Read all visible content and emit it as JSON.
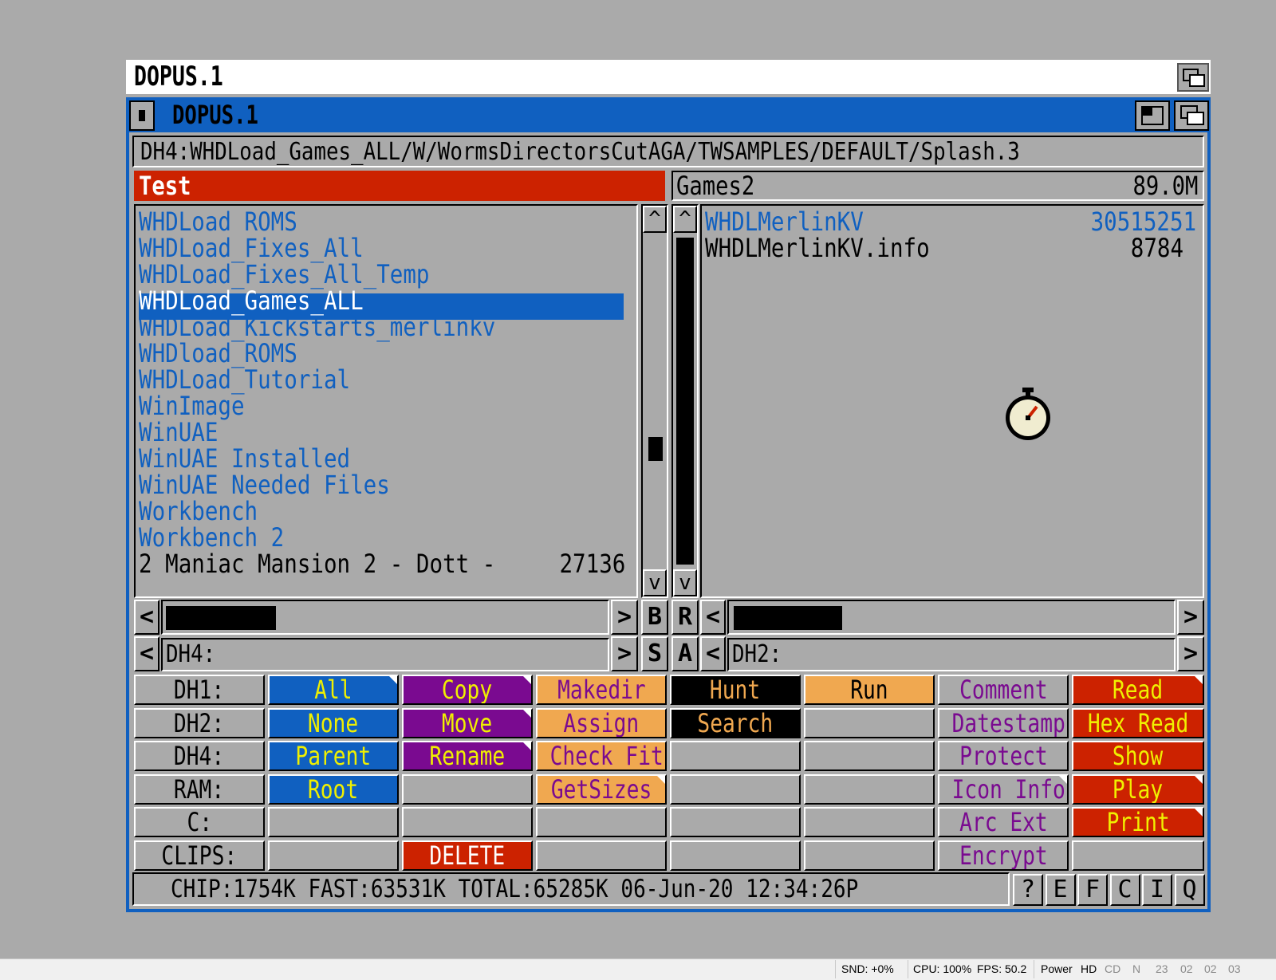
{
  "screen": {
    "title": "DOPUS.1"
  },
  "window": {
    "title": "DOPUS.1"
  },
  "path": "DH4:WHDLoad_Games_ALL/W/WormsDirectorsCutAGA/TWSAMPLES/DEFAULT/Splash.3",
  "left_lister": {
    "header": "Test",
    "entries": [
      {
        "name": "WHDLoad ROMS",
        "type": "dir"
      },
      {
        "name": "WHDLoad_Fixes_All",
        "type": "dir"
      },
      {
        "name": "WHDLoad_Fixes_All_Temp",
        "type": "dir"
      },
      {
        "name": "WHDLoad_Games_ALL",
        "type": "dir",
        "selected": true
      },
      {
        "name": "WHDLoad_Kickstarts_merlinkv",
        "type": "dir"
      },
      {
        "name": "WHDload_ROMS",
        "type": "dir"
      },
      {
        "name": "WHDLoad_Tutorial",
        "type": "dir"
      },
      {
        "name": "WinImage",
        "type": "dir"
      },
      {
        "name": "WinUAE",
        "type": "dir"
      },
      {
        "name": "WinUAE Installed",
        "type": "dir"
      },
      {
        "name": "WinUAE Needed Files",
        "type": "dir"
      },
      {
        "name": "Workbench",
        "type": "dir"
      },
      {
        "name": "Workbench 2",
        "type": "dir"
      },
      {
        "name": "2 Maniac Mansion 2 - Dott -",
        "type": "file",
        "size": "27136"
      }
    ],
    "device_field": "DH4:"
  },
  "right_lister": {
    "header": "Games2",
    "free": "89.0M",
    "entries": [
      {
        "name": "WHDLMerlinKV",
        "type": "dir",
        "size": "30515251"
      },
      {
        "name": "WHDLMerlinKV.info",
        "type": "file",
        "size": "8784"
      }
    ],
    "device_field": "DH2:"
  },
  "center_buttons": {
    "b": "B",
    "r": "R",
    "s": "S",
    "a": "A"
  },
  "arrows": {
    "up": "^",
    "down": "v",
    "left": "<",
    "right": ">"
  },
  "device_buttons": [
    "DH1:",
    "DH2:",
    "DH4:",
    "RAM:",
    "C:",
    "CLIPS:"
  ],
  "colors": {
    "blue": "#1060c0",
    "purple": "#7a0a90",
    "orange": "#f0a850",
    "black": "#000000",
    "red": "#cc2200",
    "grey": "#aaaaaa",
    "yellow": "#f0f000",
    "white": "#ffffff"
  },
  "bank": [
    [
      {
        "label": "All",
        "bg": "#1060c0",
        "fg": "#f0f000",
        "mark": true
      },
      {
        "label": "None",
        "bg": "#1060c0",
        "fg": "#f0f000"
      },
      {
        "label": "Parent",
        "bg": "#1060c0",
        "fg": "#f0f000"
      },
      {
        "label": "Root",
        "bg": "#1060c0",
        "fg": "#f0f000"
      },
      {
        "label": "",
        "bg": "#aaaaaa",
        "fg": "#000000"
      },
      {
        "label": "",
        "bg": "#aaaaaa",
        "fg": "#000000"
      }
    ],
    [
      {
        "label": "Copy",
        "bg": "#7a0a90",
        "fg": "#f0f000",
        "mark": true
      },
      {
        "label": "Move",
        "bg": "#7a0a90",
        "fg": "#f0f000",
        "mark": true
      },
      {
        "label": "Rename",
        "bg": "#7a0a90",
        "fg": "#f0f000",
        "mark": true
      },
      {
        "label": "",
        "bg": "#aaaaaa",
        "fg": "#000000"
      },
      {
        "label": "",
        "bg": "#aaaaaa",
        "fg": "#000000"
      },
      {
        "label": "DELETE",
        "bg": "#cc2200",
        "fg": "#ffffff"
      }
    ],
    [
      {
        "label": "Makedir",
        "bg": "#f0a850",
        "fg": "#7a0a90"
      },
      {
        "label": "Assign",
        "bg": "#f0a850",
        "fg": "#7a0a90"
      },
      {
        "label": "Check Fit",
        "bg": "#f0a850",
        "fg": "#7a0a90"
      },
      {
        "label": "GetSizes",
        "bg": "#f0a850",
        "fg": "#7a0a90",
        "mark": true
      },
      {
        "label": "",
        "bg": "#aaaaaa",
        "fg": "#000000"
      },
      {
        "label": "",
        "bg": "#aaaaaa",
        "fg": "#000000"
      }
    ],
    [
      {
        "label": "Hunt",
        "bg": "#000000",
        "fg": "#f0a850"
      },
      {
        "label": "Search",
        "bg": "#000000",
        "fg": "#f0a850"
      },
      {
        "label": "",
        "bg": "#aaaaaa",
        "fg": "#000000"
      },
      {
        "label": "",
        "bg": "#aaaaaa",
        "fg": "#000000"
      },
      {
        "label": "",
        "bg": "#aaaaaa",
        "fg": "#000000"
      },
      {
        "label": "",
        "bg": "#aaaaaa",
        "fg": "#000000"
      }
    ],
    [
      {
        "label": "Run",
        "bg": "#f0a850",
        "fg": "#000000"
      },
      {
        "label": "",
        "bg": "#aaaaaa",
        "fg": "#000000"
      },
      {
        "label": "",
        "bg": "#aaaaaa",
        "fg": "#000000"
      },
      {
        "label": "",
        "bg": "#aaaaaa",
        "fg": "#000000"
      },
      {
        "label": "",
        "bg": "#aaaaaa",
        "fg": "#000000"
      },
      {
        "label": "",
        "bg": "#aaaaaa",
        "fg": "#000000"
      }
    ],
    [
      {
        "label": "Comment",
        "bg": "#aaaaaa",
        "fg": "#7a0a90"
      },
      {
        "label": "Datestamp",
        "bg": "#aaaaaa",
        "fg": "#7a0a90"
      },
      {
        "label": "Protect",
        "bg": "#aaaaaa",
        "fg": "#7a0a90"
      },
      {
        "label": "Icon Info",
        "bg": "#aaaaaa",
        "fg": "#7a0a90",
        "mark": true
      },
      {
        "label": "Arc Ext",
        "bg": "#aaaaaa",
        "fg": "#7a0a90"
      },
      {
        "label": "Encrypt",
        "bg": "#aaaaaa",
        "fg": "#7a0a90"
      }
    ],
    [
      {
        "label": "Read",
        "bg": "#cc2200",
        "fg": "#f0f000",
        "mark": true
      },
      {
        "label": "Hex Read",
        "bg": "#cc2200",
        "fg": "#f0f000"
      },
      {
        "label": "Show",
        "bg": "#cc2200",
        "fg": "#f0f000"
      },
      {
        "label": "Play",
        "bg": "#cc2200",
        "fg": "#f0f000",
        "mark": true
      },
      {
        "label": "Print",
        "bg": "#cc2200",
        "fg": "#f0f000",
        "mark": true
      },
      {
        "label": "",
        "bg": "#aaaaaa",
        "fg": "#000000"
      }
    ]
  ],
  "status": "CHIP:1754K  FAST:63531K  TOTAL:65285K  06-Jun-20  12:34:26P",
  "quick_buttons": [
    "?",
    "E",
    "F",
    "C",
    "I",
    "Q"
  ],
  "host_status": {
    "snd": "SND: +0%",
    "cpu": "CPU: 100%",
    "fps": "FPS: 50.2",
    "power": "Power",
    "hd": "HD",
    "cd": "CD",
    "n": "N",
    "d0": "23",
    "d1": "02",
    "d2": "02",
    "d3": "03"
  },
  "icons": {
    "pointer": "stopwatch-icon",
    "close": "close-icon",
    "depth": "depth-icon",
    "zoom": "zoom-icon"
  }
}
